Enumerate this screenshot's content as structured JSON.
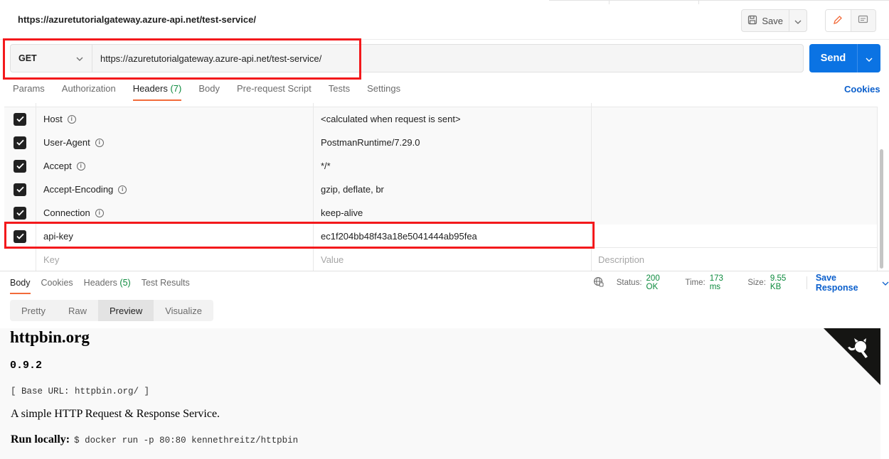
{
  "request": {
    "title": "https://azuretutorialgateway.azure-api.net/test-service/",
    "save_label": "Save",
    "method": "GET",
    "url": "https://azuretutorialgateway.azure-api.net/test-service/",
    "send_label": "Send",
    "cookies_label": "Cookies",
    "tabs": [
      {
        "label": "Params"
      },
      {
        "label": "Authorization"
      },
      {
        "label": "Headers",
        "count": "(7)"
      },
      {
        "label": "Body"
      },
      {
        "label": "Pre-request Script"
      },
      {
        "label": "Tests"
      },
      {
        "label": "Settings"
      }
    ]
  },
  "headers": [
    {
      "key": "Host",
      "value": "<calculated when request is sent>",
      "checked": true
    },
    {
      "key": "User-Agent",
      "value": "PostmanRuntime/7.29.0",
      "checked": true
    },
    {
      "key": "Accept",
      "value": "*/*",
      "checked": true
    },
    {
      "key": "Accept-Encoding",
      "value": "gzip, deflate, br",
      "checked": true
    },
    {
      "key": "Connection",
      "value": "keep-alive",
      "checked": true
    },
    {
      "key": "api-key",
      "value": "ec1f204bb48f43a18e5041444ab95fea",
      "checked": true
    }
  ],
  "headers_placeholder": {
    "key": "Key",
    "value": "Value",
    "description": "Description"
  },
  "response": {
    "tabs": [
      {
        "label": "Body"
      },
      {
        "label": "Cookies"
      },
      {
        "label": "Headers",
        "count": "(5)"
      },
      {
        "label": "Test Results"
      }
    ],
    "status_label": "Status:",
    "status_value": "200 OK",
    "time_label": "Time:",
    "time_value": "173 ms",
    "size_label": "Size:",
    "size_value": "9.55 KB",
    "save_response_label": "Save Response",
    "views": [
      "Pretty",
      "Raw",
      "Preview",
      "Visualize"
    ],
    "active_view": "Preview"
  },
  "preview": {
    "title": "httpbin.org",
    "version": "0.9.2",
    "base_url": "[ Base URL: httpbin.org/ ]",
    "description": "A simple HTTP Request & Response Service.",
    "run_label": "Run locally:",
    "run_command": "$ docker run -p 80:80 kennethreitz/httpbin"
  },
  "colors": {
    "accent_tab": "#f26b3a",
    "send_button": "#0b73e3",
    "link": "#0b5fcc",
    "ok_status": "#0c8a3d",
    "highlight_box": "#f3191c"
  }
}
